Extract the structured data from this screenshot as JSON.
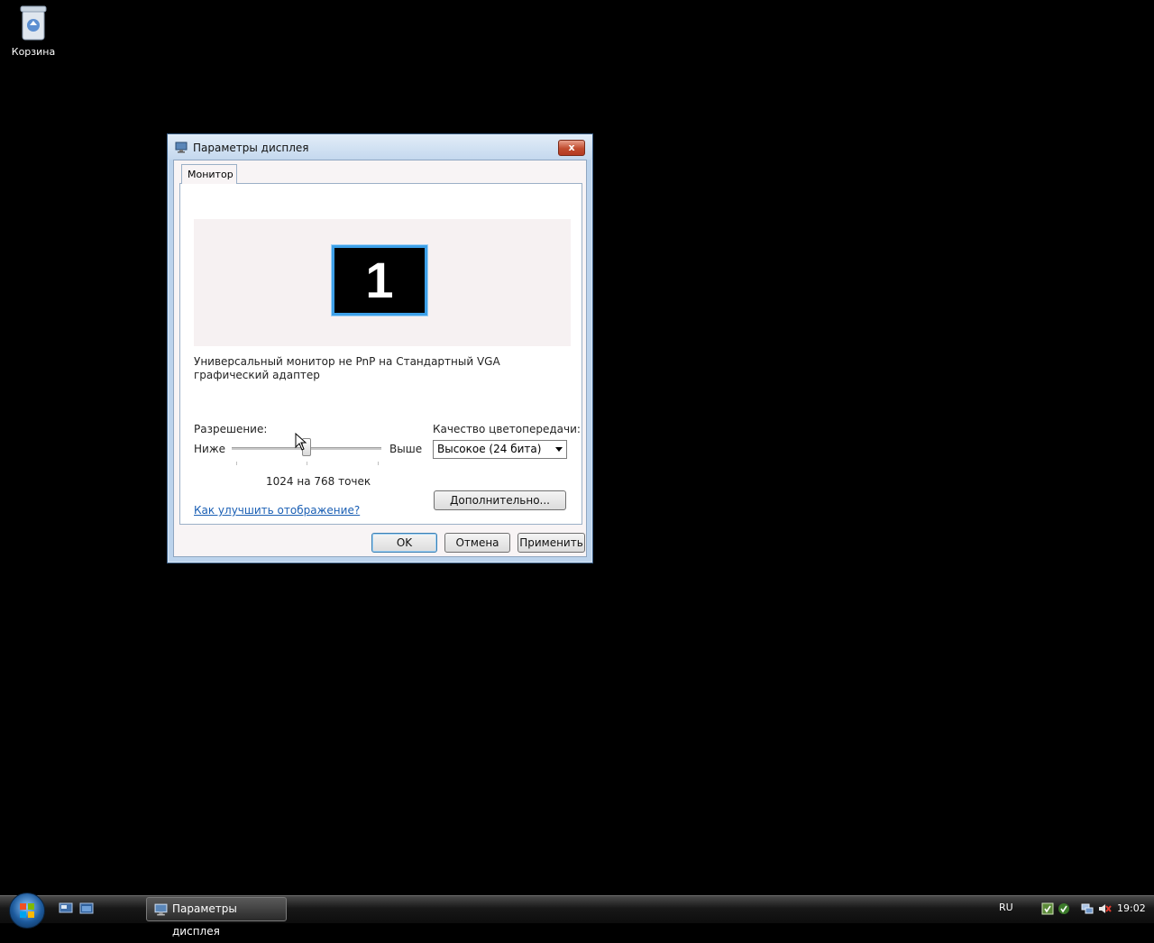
{
  "desktop": {
    "recycle_bin_label": "Корзина"
  },
  "window": {
    "title": "Параметры дисплея",
    "close_label": "x",
    "tab_label": "Монитор",
    "monitor_number": "1",
    "monitor_description": "Универсальный монитор не PnP на Стандартный VGA графический адаптер",
    "resolution_label": "Разрешение:",
    "low_label": "Ниже",
    "high_label": "Выше",
    "resolution_value": "1024 на 768 точек",
    "resolution_slider_level": 0.5,
    "color_quality_label": "Качество цветопередачи:",
    "color_quality_value": "Высокое (24 бита)",
    "help_link": "Как улучшить отображение?",
    "advanced_button": "Дополнительно...",
    "ok_button": "OK",
    "cancel_button": "Отмена",
    "apply_button": "Применить"
  },
  "taskbar": {
    "task_label": "Параметры дисплея",
    "language": "RU",
    "clock": "19:02"
  },
  "colors": {
    "monitor_border": "#3da0e8",
    "link": "#1a5fb4",
    "close_button": "#c14c2f"
  },
  "icons": [
    "recycle-bin-icon",
    "display-settings-icon",
    "start-orb-icon",
    "show-desktop-icon",
    "switch-windows-icon",
    "network-icon",
    "volume-muted-icon",
    "security-icon"
  ]
}
